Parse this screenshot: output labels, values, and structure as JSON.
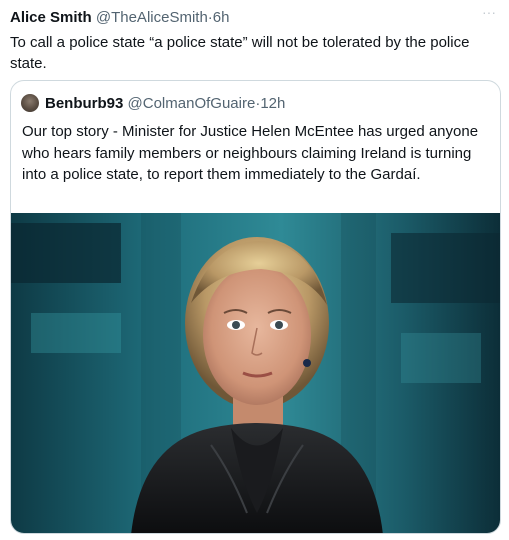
{
  "tweet": {
    "author_name": "Alice Smith",
    "author_handle": "@TheAliceSmith",
    "separator": "·",
    "time": "6h",
    "text": "To call a police state “a police state” will not be tolerated by the police state.",
    "more_icon": "more-options-icon"
  },
  "quote": {
    "author_name": "Benburb93",
    "author_handle": "@ColmanOfGuaire",
    "separator": "·",
    "time": "12h",
    "text": "Our top story - Minister for Justice Helen McEntee has urged anyone who hears family members or neighbours  claiming Ireland is turning into a police state, to report them immediately to the Gardaí.",
    "media_type": "photo"
  }
}
